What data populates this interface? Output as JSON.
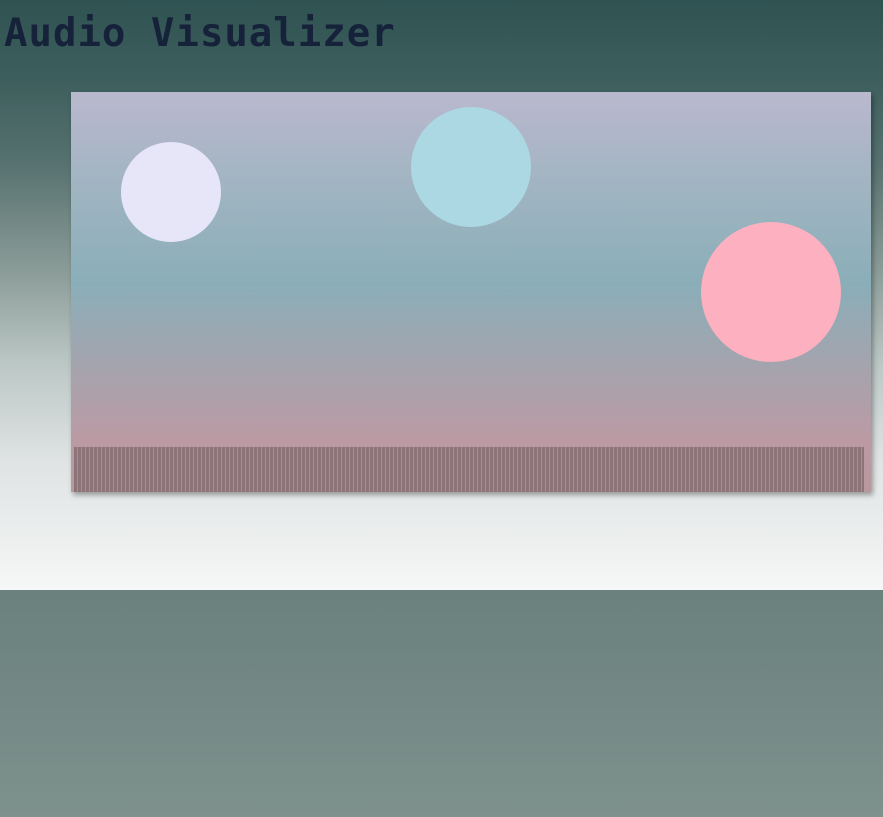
{
  "app": {
    "title": "Audio Visualizer"
  },
  "visualizer": {
    "circles": [
      {
        "name": "lavender-circle",
        "color": "#e6e6f8"
      },
      {
        "name": "lightblue-circle",
        "color": "#abd8e2"
      },
      {
        "name": "pink-circle",
        "color": "#fdb0bf"
      }
    ],
    "spectrum_color": "#8d7479"
  }
}
